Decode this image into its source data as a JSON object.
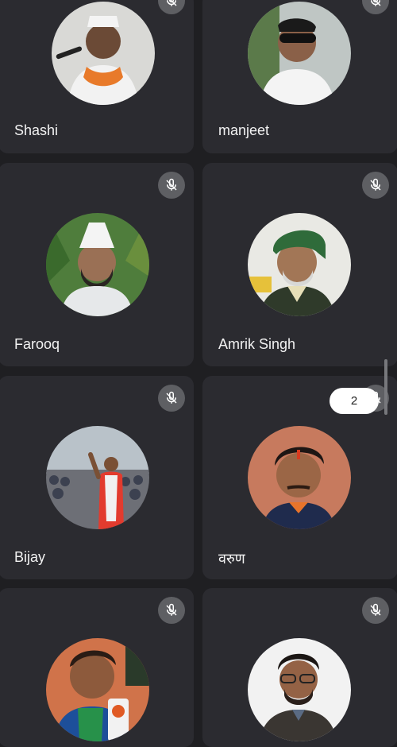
{
  "participants": [
    {
      "name": "Shashi",
      "muted": true
    },
    {
      "name": "manjeet",
      "muted": true
    },
    {
      "name": "Farooq",
      "muted": true
    },
    {
      "name": "Amrik Singh",
      "muted": true
    },
    {
      "name": "Bijay",
      "muted": true
    },
    {
      "name": "वरुण",
      "muted": true
    },
    {
      "name": "",
      "muted": true
    },
    {
      "name": "",
      "muted": true
    }
  ],
  "scroll": {
    "page_indicator": "2"
  },
  "colors": {
    "background": "#1f1f22",
    "tile": "#2b2b30",
    "mic_badge": "#5e5f63"
  },
  "icons": {
    "mic_muted": "mic-off-icon"
  }
}
